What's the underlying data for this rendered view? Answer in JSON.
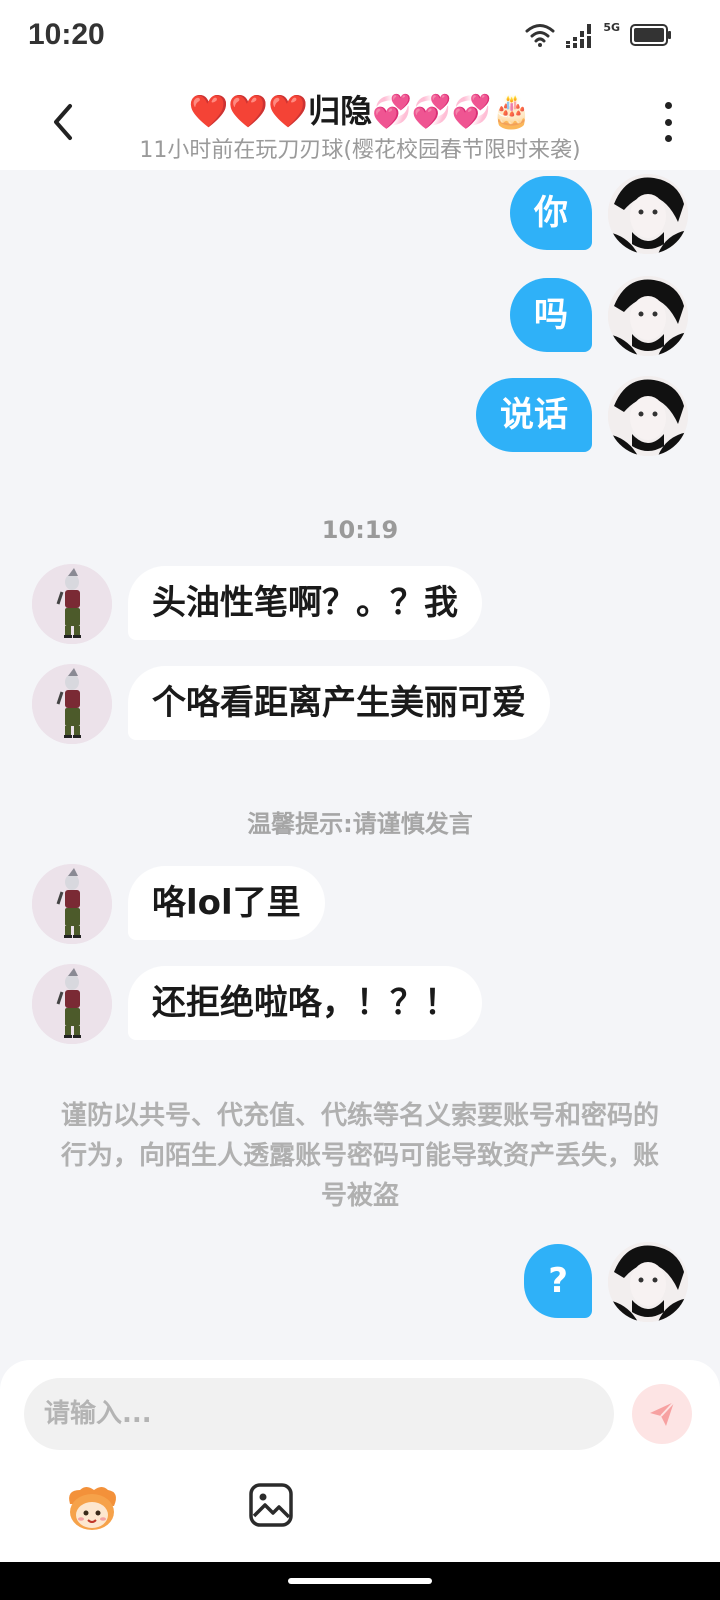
{
  "status_bar": {
    "time": "10:20",
    "network_label": "5G",
    "icons": [
      "wifi-icon",
      "signal-icon",
      "battery-icon"
    ]
  },
  "header": {
    "title": "❤️❤️❤️归隐💞💞💞🎂",
    "subtitle": "11小时前在玩刀刃球(樱花校园春节限时来袭)",
    "back_icon": "back-arrow-icon",
    "more_icon": "more-vertical-icon"
  },
  "messages": [
    {
      "sender": "self",
      "text": "你"
    },
    {
      "sender": "self",
      "text": "吗"
    },
    {
      "sender": "self",
      "text": "说话"
    },
    {
      "sender": "other",
      "text": "头油性笔啊？。？我"
    },
    {
      "sender": "other",
      "text": "个咯看距离产生美丽可爱"
    },
    {
      "sender": "other",
      "text": "咯lol了里"
    },
    {
      "sender": "other",
      "text": "还拒绝啦咯，！？！"
    },
    {
      "sender": "self",
      "text": "?"
    }
  ],
  "timestamp": "10:19",
  "tip": "温馨提示:请谨慎发言",
  "warning": "谨防以共号、代充值、代练等名义索要账号和密码的行为，向陌生人透露账号密码可能导致资产丢失，账号被盗",
  "input": {
    "placeholder": "请输入...",
    "value": ""
  },
  "toolbar": {
    "send_icon": "send-icon",
    "emoji_icon": "emoji-mascot-icon",
    "image_icon": "image-icon"
  },
  "colors": {
    "self_bubble": "#2fb1f8",
    "other_bubble": "#ffffff",
    "background": "#f4f5f8",
    "send_button": "#fde4e4",
    "send_icon": "#f7a1a1"
  }
}
